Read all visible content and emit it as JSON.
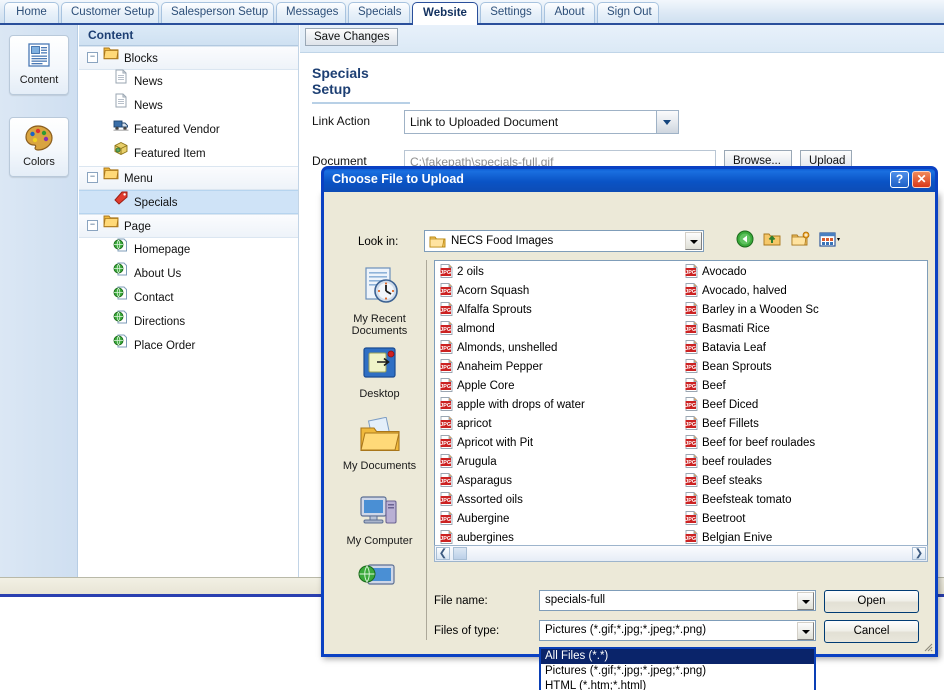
{
  "app": {
    "tabs": [
      {
        "label": "Home",
        "active": false
      },
      {
        "label": "Customer Setup",
        "active": false
      },
      {
        "label": "Salesperson Setup",
        "active": false
      },
      {
        "label": "Messages",
        "active": false
      },
      {
        "label": "Specials",
        "active": false
      },
      {
        "label": "Website",
        "active": true
      },
      {
        "label": "Settings",
        "active": false
      },
      {
        "label": "About",
        "active": false
      },
      {
        "label": "Sign Out",
        "active": false
      }
    ],
    "rail": [
      {
        "label": "Content",
        "icon": "content-icon"
      },
      {
        "label": "Colors",
        "icon": "palette-icon"
      }
    ],
    "tree": {
      "header": "Content",
      "nodes": [
        {
          "label": "Blocks",
          "type": "group",
          "icon": "folder-icon"
        },
        {
          "label": "News",
          "type": "child",
          "icon": "page-icon"
        },
        {
          "label": "News",
          "type": "child",
          "icon": "page-icon"
        },
        {
          "label": "Featured Vendor",
          "type": "child",
          "icon": "truck-icon"
        },
        {
          "label": "Featured Item",
          "type": "child",
          "icon": "package-icon"
        },
        {
          "label": "Menu",
          "type": "group",
          "icon": "folder-icon"
        },
        {
          "label": "Specials",
          "type": "child",
          "icon": "tag-icon",
          "selected": true
        },
        {
          "label": "Page",
          "type": "group",
          "icon": "folder-icon"
        },
        {
          "label": "Homepage",
          "type": "child",
          "icon": "web-page-icon"
        },
        {
          "label": "About Us",
          "type": "child",
          "icon": "web-page-icon"
        },
        {
          "label": "Contact",
          "type": "child",
          "icon": "web-page-icon"
        },
        {
          "label": "Directions",
          "type": "child",
          "icon": "web-page-icon"
        },
        {
          "label": "Place Order",
          "type": "child",
          "icon": "web-page-icon"
        }
      ]
    },
    "main": {
      "save_label": "Save Changes",
      "section_title": "Specials Setup",
      "link_action_label": "Link Action",
      "link_action_value": "Link to Uploaded Document",
      "document_label": "Document",
      "document_value": "C:\\fakepath\\specials-full.gif",
      "browse_label": "Browse...",
      "upload_label": "Upload"
    }
  },
  "dialog": {
    "title": "Choose File to Upload",
    "help_label": "?",
    "close_label": "✕",
    "lookin_label": "Look in:",
    "lookin_value": "NECS Food Images",
    "nav_icons": [
      "back-icon",
      "up-one-level-icon",
      "new-folder-icon",
      "views-icon"
    ],
    "places": [
      {
        "label": "My Recent Documents",
        "icon": "recent-documents-icon"
      },
      {
        "label": "Desktop",
        "icon": "desktop-icon"
      },
      {
        "label": "My Documents",
        "icon": "my-documents-icon"
      },
      {
        "label": "My Computer",
        "icon": "my-computer-icon"
      },
      {
        "label": "",
        "icon": "my-network-places-icon"
      }
    ],
    "files_left": [
      "2 oils",
      "Acorn Squash",
      "Alfalfa Sprouts",
      "almond",
      "Almonds, unshelled",
      "Anaheim Pepper",
      "Apple Core",
      "apple with drops of water",
      "apricot",
      "Apricot with Pit",
      "Arugula",
      "Asparagus",
      "Assorted oils",
      "Aubergine",
      "aubergines"
    ],
    "files_right": [
      "Avocado",
      "Avocado, halved",
      "Barley in a Wooden Sc",
      "Basmati Rice",
      "Batavia Leaf",
      "Bean Sprouts",
      "Beef",
      "Beef Diced",
      "Beef Fillets",
      "Beef for beef roulades",
      "beef roulades",
      "Beef steaks",
      "Beefsteak tomato",
      "Beetroot",
      "Belgian Enive"
    ],
    "filename_label": "File name:",
    "filename_value": "specials-full",
    "filetype_label": "Files of type:",
    "filetype_value": "Pictures (*.gif;*.jpg;*.jpeg;*.png)",
    "filetype_options": [
      "All Files (*.*)",
      "Pictures (*.gif;*.jpg;*.jpeg;*.png)",
      "HTML (*.htm;*.html)"
    ],
    "filetype_selected_index": 0,
    "open_label": "Open",
    "cancel_label": "Cancel"
  },
  "colors": {
    "tab_active_text": "#12315f",
    "accent_blue": "#2a4f9b",
    "dialog_title_blue": "#0a41c3",
    "selection_blue": "#0a246a",
    "jpg_red": "#cc2222"
  }
}
